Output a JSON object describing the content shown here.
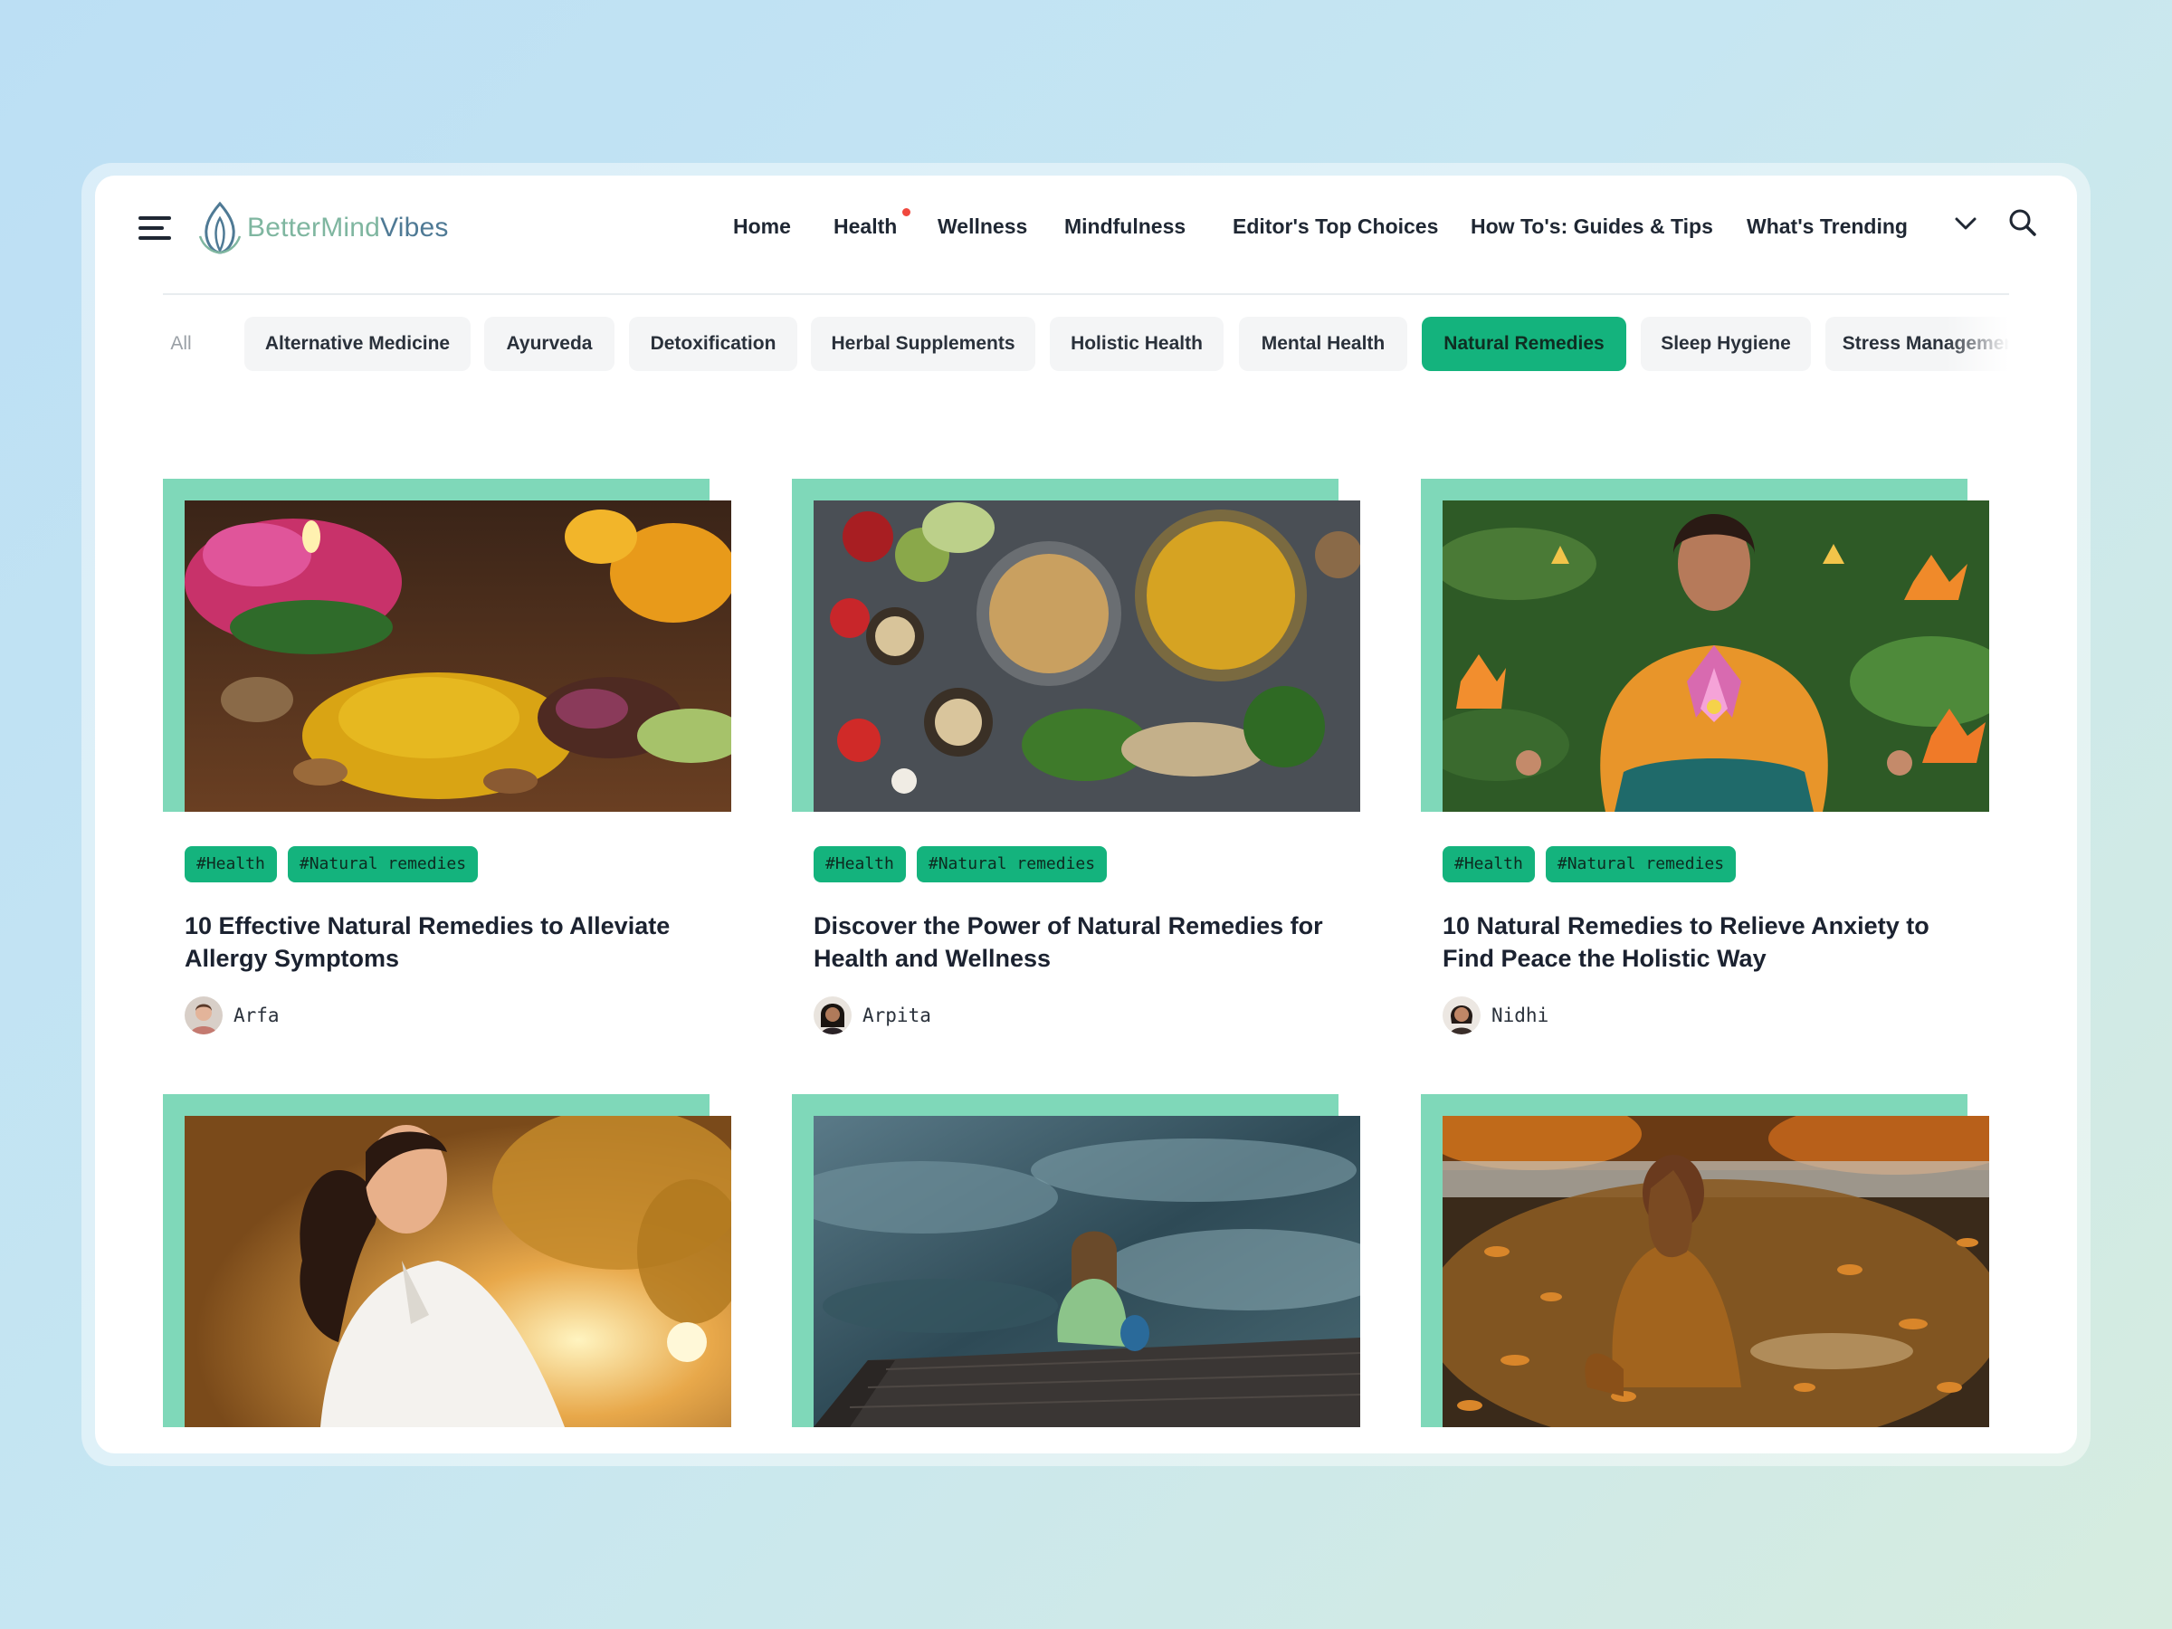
{
  "brand": {
    "name_part1": "BetterMind",
    "name_part2": "Vibes"
  },
  "nav": {
    "items": [
      "Home",
      "Health",
      "Wellness",
      "Mindfulness",
      "Editor's Top Choices",
      "How To's: Guides & Tips",
      "What's Trending"
    ],
    "notification_color": "#f0483e"
  },
  "filters": {
    "items": [
      "All",
      "Alternative Medicine",
      "Ayurveda",
      "Detoxification",
      "Herbal Supplements",
      "Holistic Health",
      "Mental Health",
      "Natural Remedies",
      "Sleep Hygiene",
      "Stress Management"
    ],
    "active": "Natural Remedies"
  },
  "colors": {
    "accent": "#14b37d",
    "frame": "#7fd8b9",
    "text": "#1b2230"
  },
  "articles": [
    {
      "tags": [
        "#Health",
        "#Natural remedies"
      ],
      "title": "10 Effective Natural Remedies to Alleviate Allergy Symptoms",
      "author": "Arfa"
    },
    {
      "tags": [
        "#Health",
        "#Natural remedies"
      ],
      "title": "Discover the Power of Natural Remedies for Health and Wellness",
      "author": "Arpita"
    },
    {
      "tags": [
        "#Health",
        "#Natural remedies"
      ],
      "title": "10 Natural Remedies to Relieve Anxiety to Find Peace the Holistic Way",
      "author": "Nidhi"
    },
    {
      "image": "woman-sunset-meditation"
    },
    {
      "image": "person-on-dock-by-lake"
    },
    {
      "image": "woman-autumn-leaves-lake"
    }
  ]
}
